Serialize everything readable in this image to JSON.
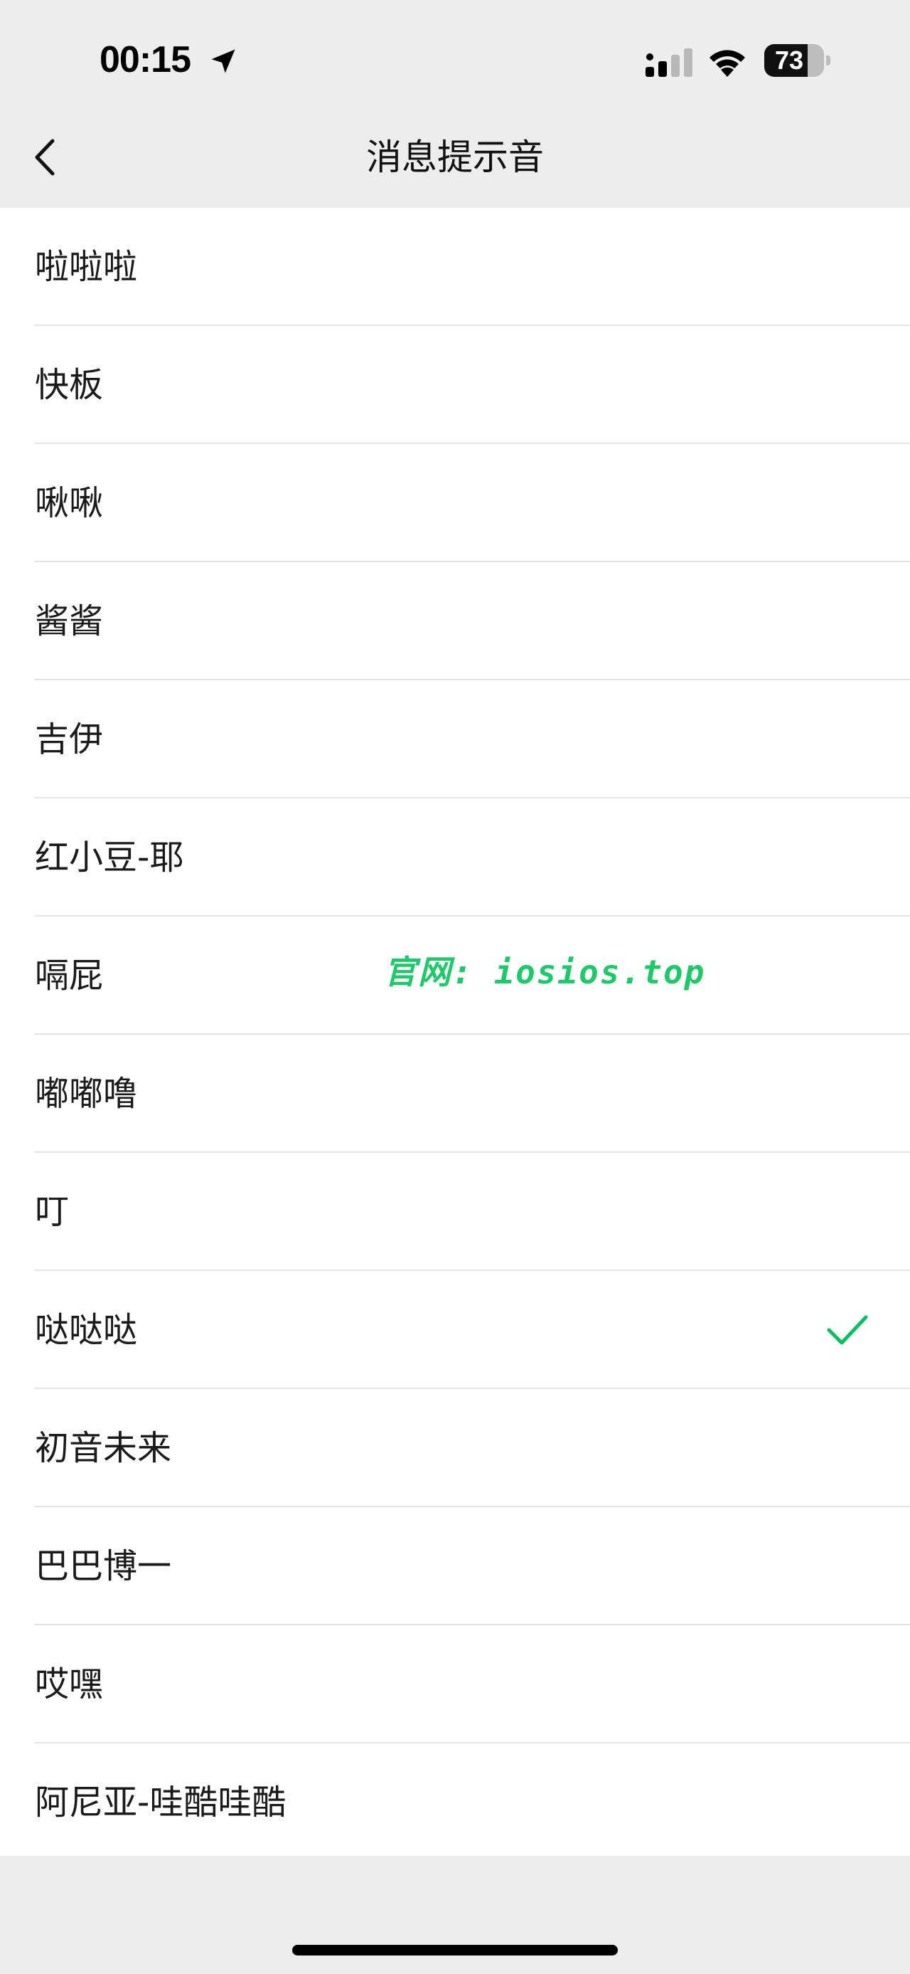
{
  "status_bar": {
    "time": "00:15",
    "battery_level": "73",
    "battery_percent": 73,
    "signal_bars_active": 2,
    "signal_bars_total": 4
  },
  "nav": {
    "title": "消息提示音",
    "back_icon": "chevron-left-icon"
  },
  "list": {
    "items": [
      {
        "label": "啦啦啦",
        "selected": false
      },
      {
        "label": "快板",
        "selected": false
      },
      {
        "label": "啾啾",
        "selected": false
      },
      {
        "label": "酱酱",
        "selected": false
      },
      {
        "label": "吉伊",
        "selected": false
      },
      {
        "label": "红小豆-耶",
        "selected": false
      },
      {
        "label": "嗝屁",
        "selected": false
      },
      {
        "label": "嘟嘟噜",
        "selected": false
      },
      {
        "label": "叮",
        "selected": false
      },
      {
        "label": "哒哒哒",
        "selected": true
      },
      {
        "label": "初音未来",
        "selected": false
      },
      {
        "label": "巴巴博一",
        "selected": false
      },
      {
        "label": "哎嘿",
        "selected": false
      },
      {
        "label": "阿尼亚-哇酷哇酷",
        "selected": false
      }
    ],
    "check_icon": "checkmark-icon"
  },
  "watermark": {
    "text": "官网: iosios.top"
  },
  "colors": {
    "accent": "#07c160",
    "background": "#ededed",
    "watermark": "#1ec96a"
  }
}
